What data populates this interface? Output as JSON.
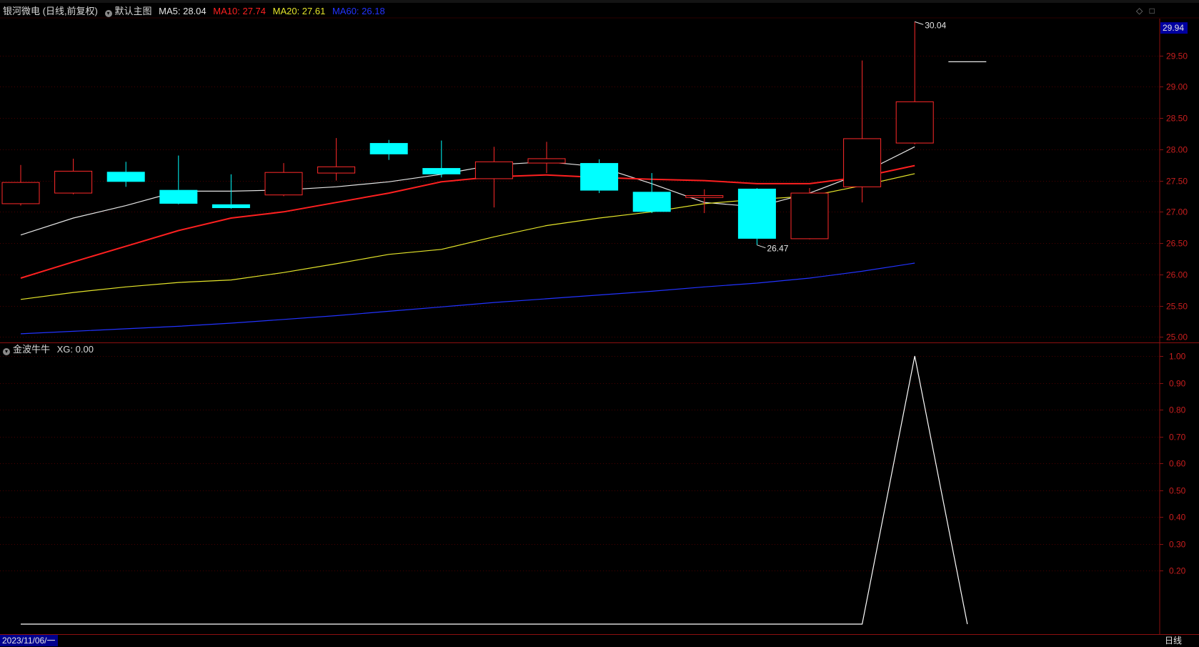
{
  "header": {
    "stock_title": "银河微电 (日线,前复权)",
    "template_name": "默认主图",
    "indicator_name": "金波牛牛",
    "indicator_value_label": "XG: 0.00"
  },
  "ma_legend": [
    {
      "label": "MA5: 28.04",
      "color": "#e6e6e6"
    },
    {
      "label": "MA10: 27.74",
      "color": "#ff2020"
    },
    {
      "label": "MA20: 27.61",
      "color": "#e5e52a"
    },
    {
      "label": "MA60: 26.18",
      "color": "#2233ff"
    }
  ],
  "footer": {
    "date_label": "2023/11/06/一",
    "period_label": "日线"
  },
  "colors": {
    "background": "#000000",
    "grid": "#4a0000",
    "axis_border": "#8c1010",
    "axis_text": "#c81e1e",
    "up_candle": "#ff2a2a",
    "down_candle": "#00ffff",
    "price_tag_bg": "#0000a0"
  },
  "chart_data": [
    {
      "type": "candlestick",
      "y_axis_side": "right",
      "ylim": [
        24.9,
        30.15
      ],
      "y_ticks": [
        "25.00",
        "25.50",
        "26.00",
        "26.50",
        "27.00",
        "27.50",
        "28.00",
        "28.50",
        "29.00",
        "29.50"
      ],
      "last_price_tag": "29.94",
      "high_annotation": "30.04",
      "low_annotation": "26.47",
      "candles": [
        {
          "open": 27.13,
          "close": 27.47,
          "high": 27.75,
          "low": 27.1
        },
        {
          "open": 27.3,
          "close": 27.65,
          "high": 27.85,
          "low": 27.28
        },
        {
          "open": 27.64,
          "close": 27.48,
          "high": 27.8,
          "low": 27.4
        },
        {
          "open": 27.35,
          "close": 27.13,
          "high": 27.9,
          "low": 27.12
        },
        {
          "open": 27.12,
          "close": 27.06,
          "high": 27.6,
          "low": 27.05
        },
        {
          "open": 27.27,
          "close": 27.63,
          "high": 27.78,
          "low": 27.25
        },
        {
          "open": 27.62,
          "close": 27.72,
          "high": 28.18,
          "low": 27.5
        },
        {
          "open": 28.1,
          "close": 27.92,
          "high": 28.15,
          "low": 27.83
        },
        {
          "open": 27.7,
          "close": 27.6,
          "high": 28.14,
          "low": 27.55
        },
        {
          "open": 27.53,
          "close": 27.8,
          "high": 28.04,
          "low": 27.07
        },
        {
          "open": 27.78,
          "close": 27.85,
          "high": 28.12,
          "low": 27.62
        },
        {
          "open": 27.78,
          "close": 27.34,
          "high": 27.84,
          "low": 27.3
        },
        {
          "open": 27.32,
          "close": 27.0,
          "high": 27.62,
          "low": 26.98
        },
        {
          "open": 27.23,
          "close": 27.26,
          "high": 27.36,
          "low": 26.98
        },
        {
          "open": 27.37,
          "close": 26.57,
          "high": 27.38,
          "low": 26.47
        },
        {
          "open": 26.57,
          "close": 27.3,
          "high": 27.38,
          "low": 26.56
        },
        {
          "open": 27.4,
          "close": 28.17,
          "high": 29.42,
          "low": 27.15
        },
        {
          "open": 28.1,
          "close": 28.76,
          "high": 30.04,
          "low": 28.08
        },
        {
          "open": 29.4,
          "close": 29.4,
          "high": 29.4,
          "low": 29.4
        }
      ],
      "ma_series": [
        {
          "name": "MA5",
          "color": "#e6e6e6",
          "values": [
            26.63,
            26.9,
            27.1,
            27.33,
            27.33,
            27.35,
            27.4,
            27.48,
            27.6,
            27.75,
            27.8,
            27.72,
            27.45,
            27.15,
            27.08,
            27.3,
            27.62,
            28.04
          ]
        },
        {
          "name": "MA10",
          "color": "#ff2020",
          "values": [
            25.94,
            26.2,
            26.45,
            26.7,
            26.9,
            27.0,
            27.15,
            27.3,
            27.48,
            27.56,
            27.59,
            27.55,
            27.52,
            27.5,
            27.45,
            27.45,
            27.56,
            27.74
          ]
        },
        {
          "name": "MA20",
          "color": "#e5e52a",
          "values": [
            25.6,
            25.71,
            25.8,
            25.87,
            25.91,
            26.03,
            26.17,
            26.32,
            26.4,
            26.6,
            26.78,
            26.9,
            27.0,
            27.13,
            27.2,
            27.25,
            27.42,
            27.61
          ]
        },
        {
          "name": "MA60",
          "color": "#2233ff",
          "values": [
            25.05,
            25.09,
            25.13,
            25.17,
            25.22,
            25.28,
            25.34,
            25.41,
            25.48,
            25.55,
            25.61,
            25.67,
            25.73,
            25.8,
            25.86,
            25.94,
            26.05,
            26.18
          ]
        }
      ]
    },
    {
      "type": "line",
      "name": "XG",
      "y_axis_side": "right",
      "ylim": [
        0,
        1.0
      ],
      "y_ticks": [
        "0.20",
        "0.30",
        "0.40",
        "0.50",
        "0.60",
        "0.70",
        "0.80",
        "0.90",
        "1.00"
      ],
      "color": "#ffffff",
      "values": [
        0,
        0,
        0,
        0,
        0,
        0,
        0,
        0,
        0,
        0,
        0,
        0,
        0,
        0,
        0,
        0,
        0,
        1,
        0
      ]
    }
  ]
}
